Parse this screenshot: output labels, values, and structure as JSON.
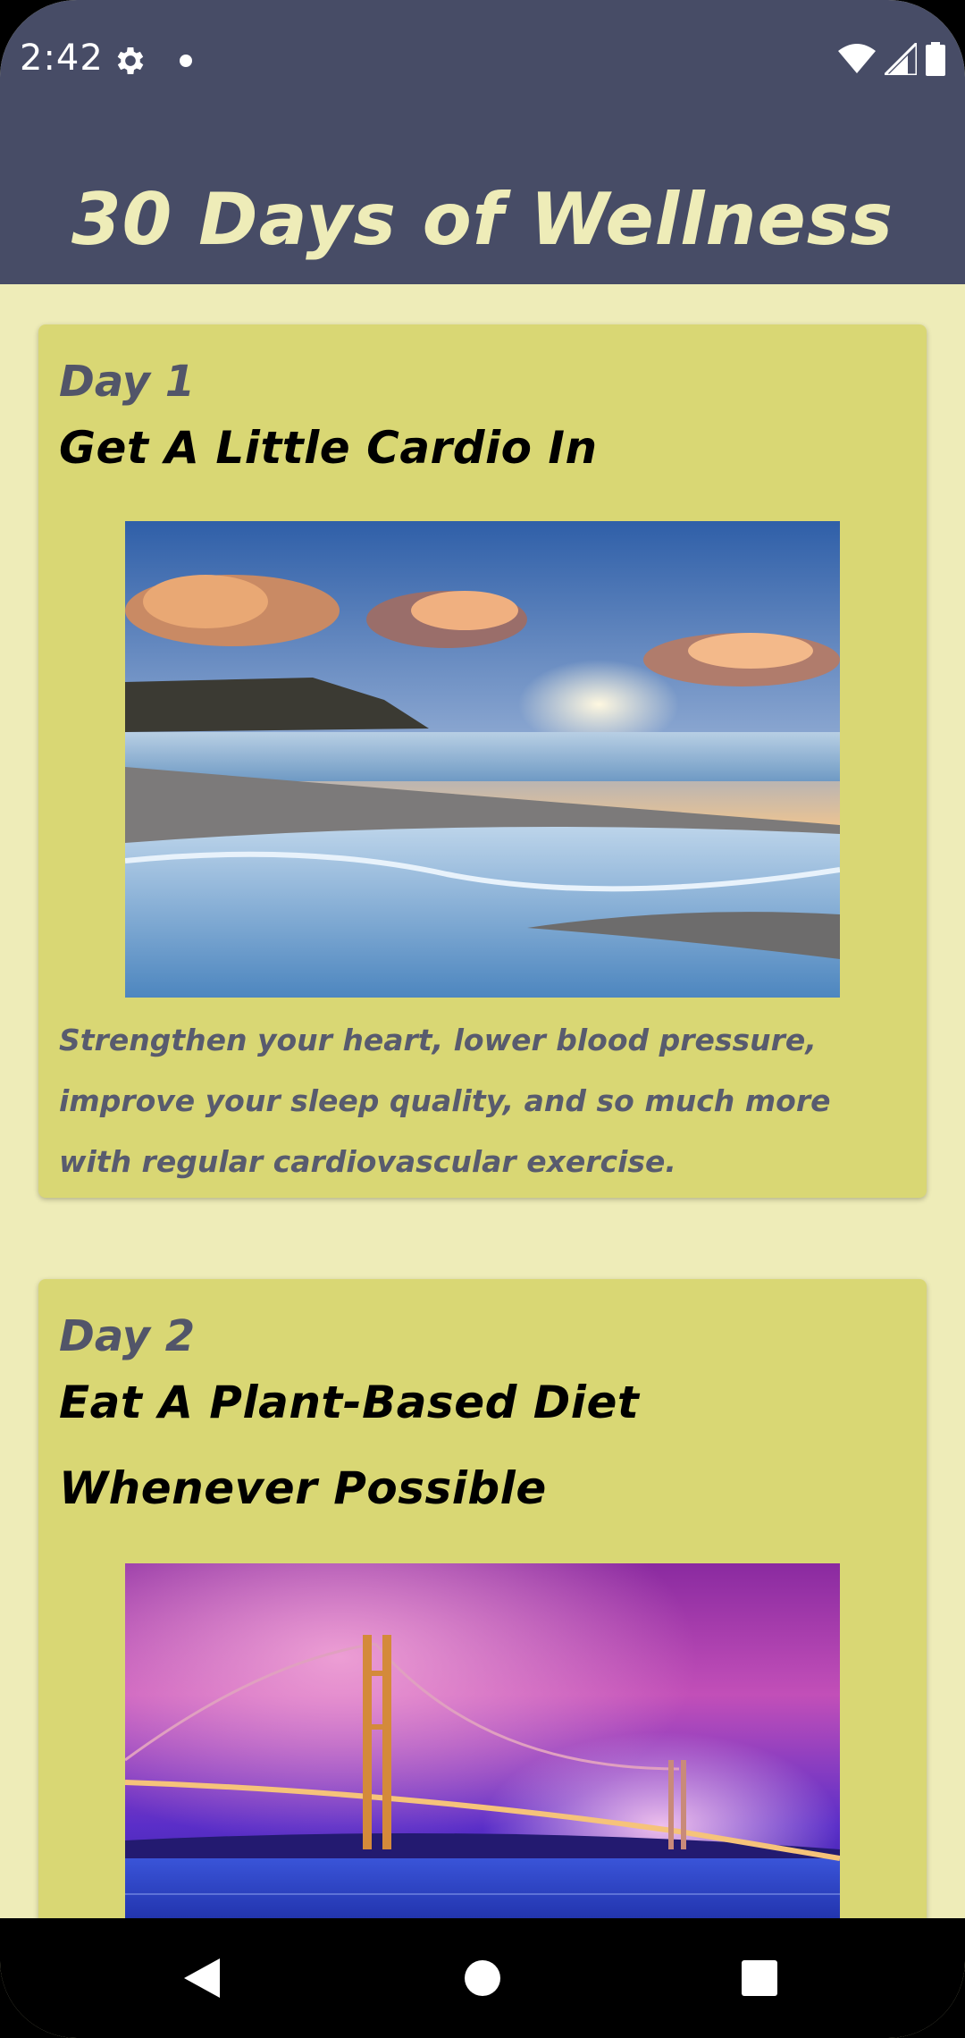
{
  "status_bar": {
    "time": "2:42",
    "icons": [
      "settings-icon",
      "notification-dot-icon",
      "wifi-icon",
      "signal-icon",
      "battery-icon"
    ]
  },
  "app_bar": {
    "title": "30 Days of Wellness"
  },
  "colors": {
    "app_bar": "#474c66",
    "title_text": "#eeecb8",
    "background": "#eeecb8",
    "card": "#d9d774",
    "day_label": "#525569"
  },
  "cards": [
    {
      "day": "Day 1",
      "title": "Get A Little Cardio In",
      "image": "sunset-beach-photo",
      "description": "Strengthen your heart, lower blood pressure, improve your sleep quality, and so much more with regular cardiovascular exercise."
    },
    {
      "day": "Day 2",
      "title": "Eat A Plant-Based Diet Whenever Possible",
      "image": "golden-gate-bridge-photo",
      "description": ""
    }
  ],
  "nav_bar": {
    "buttons": [
      "back-icon",
      "home-icon",
      "recents-icon"
    ]
  }
}
